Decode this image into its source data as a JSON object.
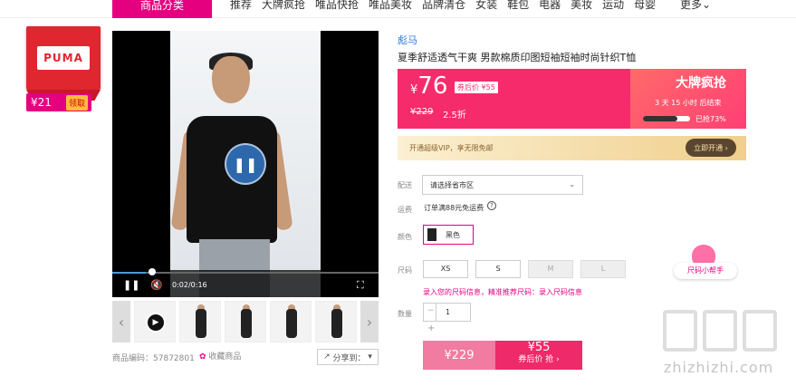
{
  "nav": {
    "category_button": "商品分类",
    "links": [
      "推荐",
      "大牌疯抢",
      "唯品快抢",
      "唯品美妆",
      "品牌清仓",
      "女装",
      "鞋包",
      "电器",
      "美妆",
      "运动",
      "母婴"
    ],
    "more": "更多"
  },
  "brand_card": {
    "logo_text": "PUMA",
    "coupon_amount": "¥21",
    "coupon_action": "领取"
  },
  "video": {
    "time": "0:02/0:16",
    "progress_fraction": 0.125
  },
  "product": {
    "brand": "彪马",
    "title": "夏季舒适透气干爽 男款棉质印图短袖短袖时尚针织T恤",
    "price_symbol": "¥",
    "price": "76",
    "after_coupon_label": "券后价 ¥55",
    "original_price": "¥229",
    "discount": "2.5折",
    "sku_label": "商品编码：",
    "sku": "57872801",
    "favorite_label": "收藏商品",
    "share_label": "分享到："
  },
  "flash_sale": {
    "title": "大牌疯抢",
    "countdown": "3 天 15 小时 后结束",
    "sold_label": "已抢73%",
    "sold_fraction": 0.73
  },
  "vip": {
    "text": "开通超级VIP，享无限免邮",
    "button": "立即开通"
  },
  "options": {
    "delivery_label": "配送",
    "delivery_placeholder": "请选择省市区",
    "shipping_label": "运费",
    "shipping_text": "订单满88元免运费",
    "color_label": "颜色",
    "color_value": "黑色",
    "size_label": "尺码",
    "sizes": [
      "XS",
      "S",
      "M",
      "L"
    ],
    "size_tip": "录入您的尺码信息，精准推荐尺码：录入尺码信息",
    "qty_label": "数量",
    "qty_value": "1",
    "qty_minus": "−",
    "qty_plus": "+"
  },
  "buy": {
    "orig_price": "¥229",
    "coupon_price": "¥55",
    "coupon_action": "券后价 抢"
  },
  "helper": {
    "label": "尺码小帮手"
  },
  "watermark": {
    "text": "zhizhizhi.com"
  },
  "colors": {
    "accent": "#e4007f",
    "price_bg": "#f62b6b",
    "brand_red": "#e0262f"
  }
}
